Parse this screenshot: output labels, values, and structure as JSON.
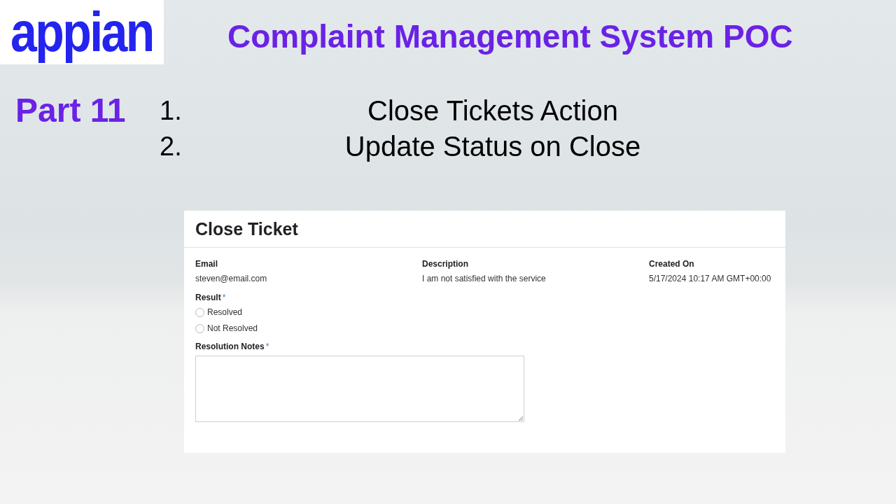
{
  "logo": {
    "text": "appian"
  },
  "title": "Complaint Management System POC",
  "part_label": "Part 11",
  "agenda": [
    {
      "number": "1.",
      "text": "Close Tickets Action"
    },
    {
      "number": "2.",
      "text": "Update Status on Close"
    }
  ],
  "form": {
    "title": "Close Ticket",
    "details": [
      {
        "label": "Email",
        "value": "steven@email.com"
      },
      {
        "label": "Description",
        "value": "I am not satisfied with the service"
      },
      {
        "label": "Created On",
        "value": "5/17/2024 10:17 AM GMT+00:00"
      }
    ],
    "result": {
      "label": "Result",
      "required_mark": "*",
      "options": [
        {
          "label": "Resolved",
          "selected": false
        },
        {
          "label": "Not Resolved",
          "selected": false
        }
      ]
    },
    "resolution_notes": {
      "label": "Resolution Notes",
      "required_mark": "*"
    }
  }
}
